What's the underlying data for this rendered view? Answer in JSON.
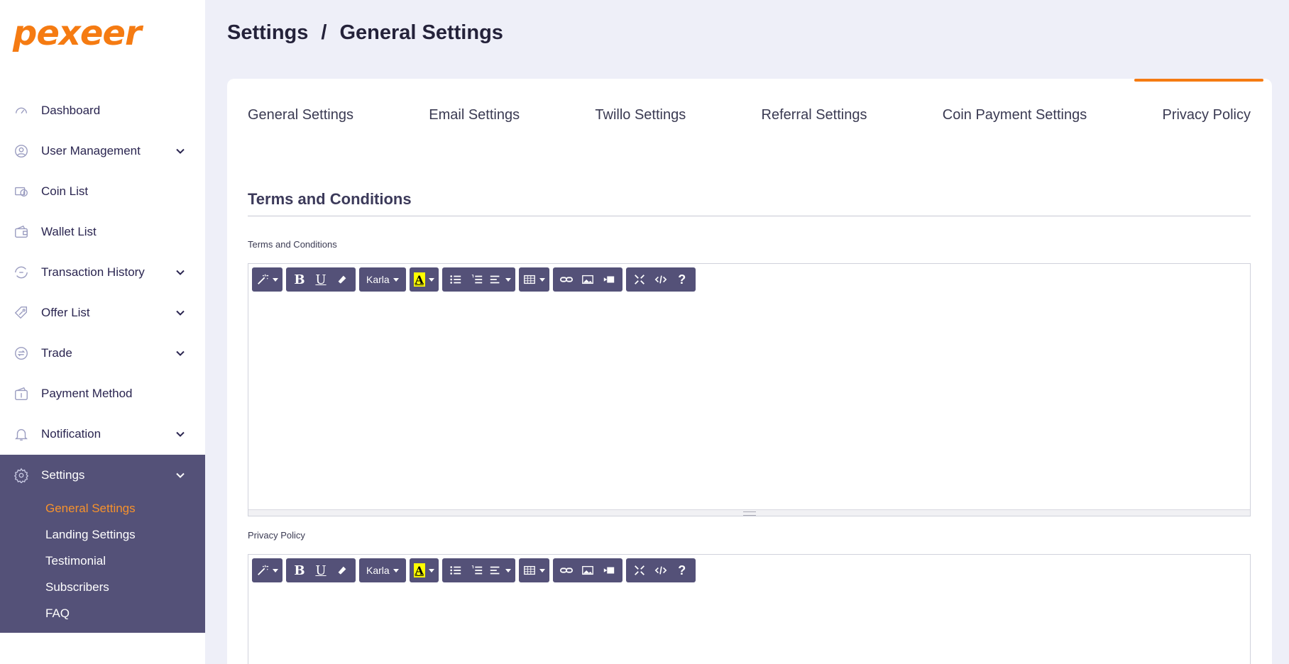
{
  "brand": {
    "logo_text": "pexeer",
    "accent": "#f57b12"
  },
  "sidebar": {
    "items": [
      {
        "label": "Dashboard",
        "icon": "speedometer-icon",
        "has_submenu": false
      },
      {
        "label": "User Management",
        "icon": "user-icon",
        "has_submenu": true
      },
      {
        "label": "Coin List",
        "icon": "coins-icon",
        "has_submenu": false
      },
      {
        "label": "Wallet List",
        "icon": "wallet-icon",
        "has_submenu": false
      },
      {
        "label": "Transaction History",
        "icon": "transaction-icon",
        "has_submenu": true
      },
      {
        "label": "Offer List",
        "icon": "tag-icon",
        "has_submenu": true
      },
      {
        "label": "Trade",
        "icon": "exchange-icon",
        "has_submenu": true
      },
      {
        "label": "Payment Method",
        "icon": "payment-icon",
        "has_submenu": false
      },
      {
        "label": "Notification",
        "icon": "bell-icon",
        "has_submenu": true
      }
    ],
    "settings": {
      "label": "Settings",
      "icon": "gear-icon",
      "subitems": [
        {
          "label": "General Settings",
          "active": true
        },
        {
          "label": "Landing Settings",
          "active": false
        },
        {
          "label": "Testimonial",
          "active": false
        },
        {
          "label": "Subscribers",
          "active": false
        },
        {
          "label": "FAQ",
          "active": false
        }
      ]
    }
  },
  "breadcrumb": {
    "parent": "Settings",
    "separator": "/",
    "current": "General Settings"
  },
  "tabs": [
    {
      "label": "General Settings"
    },
    {
      "label": "Email Settings"
    },
    {
      "label": "Twillo Settings"
    },
    {
      "label": "Referral Settings"
    },
    {
      "label": "Coin Payment Settings"
    },
    {
      "label": "Privacy Policy",
      "active": true
    }
  ],
  "section": {
    "title": "Terms and Conditions"
  },
  "editors": [
    {
      "label": "Terms and Conditions",
      "font": "Karla"
    },
    {
      "label": "Privacy Policy",
      "font": "Karla"
    }
  ]
}
